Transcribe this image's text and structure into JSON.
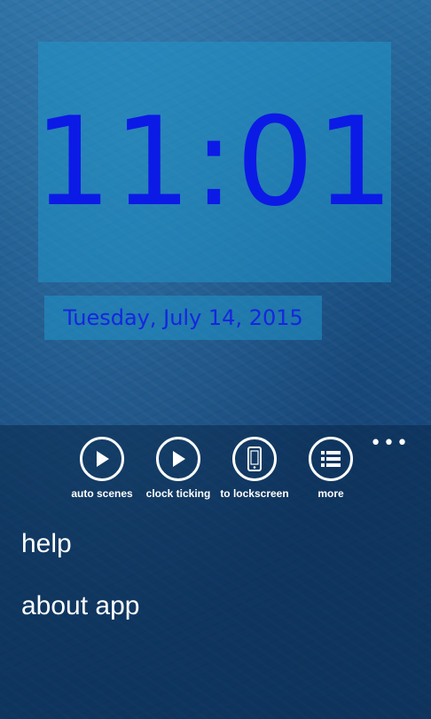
{
  "clock": {
    "time": "11:01",
    "date": "Tuesday, July 14, 2015"
  },
  "app_bar": {
    "more_glyph": "•••",
    "buttons": [
      {
        "label": "auto scenes",
        "icon": "play-icon"
      },
      {
        "label": "clock ticking",
        "icon": "play-icon"
      },
      {
        "label": "to lockscreen",
        "icon": "phone-icon"
      },
      {
        "label": "more",
        "icon": "list-icon"
      }
    ],
    "menu": [
      {
        "label": "help"
      },
      {
        "label": "about app"
      }
    ]
  },
  "colors": {
    "clock_text": "#0c1ae6",
    "panel_bg": "#2096c8",
    "app_bar_bg": "#0a284b",
    "icon_white": "#ffffff"
  }
}
